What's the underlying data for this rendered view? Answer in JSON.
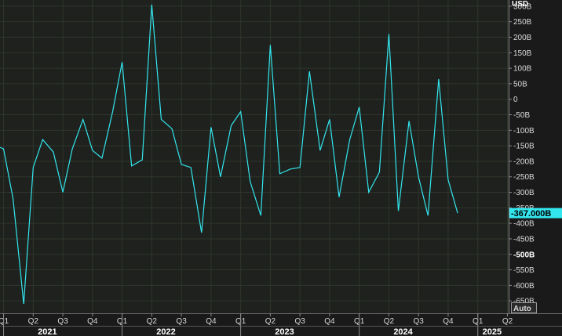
{
  "chart_data": {
    "type": "line",
    "unit_label": "USD",
    "auto_label": "Auto",
    "ylim": [
      -690,
      320
    ],
    "xlim": [
      2020.97,
      2025.26
    ],
    "grid": true,
    "line_color": "#33e6ee",
    "last_value_label": "-367.000B",
    "last_value": -367,
    "y_ticks": [
      {
        "value": 300,
        "label": "300B"
      },
      {
        "value": 250,
        "label": "250B"
      },
      {
        "value": 200,
        "label": "200B"
      },
      {
        "value": 150,
        "label": "150B"
      },
      {
        "value": 100,
        "label": "100B"
      },
      {
        "value": 50,
        "label": "50B"
      },
      {
        "value": 0,
        "label": "0"
      },
      {
        "value": -50,
        "label": "-50B"
      },
      {
        "value": -100,
        "label": "-100B"
      },
      {
        "value": -150,
        "label": "-150B"
      },
      {
        "value": -200,
        "label": "-200B"
      },
      {
        "value": -250,
        "label": "-250B"
      },
      {
        "value": -300,
        "label": "-300B"
      },
      {
        "value": -350,
        "label": "-350B"
      },
      {
        "value": -400,
        "label": "-400B"
      },
      {
        "value": -450,
        "label": "-450B"
      },
      {
        "value": -500,
        "label": "-500B"
      },
      {
        "value": -550,
        "label": "-550B"
      },
      {
        "value": -600,
        "label": "-600B"
      },
      {
        "value": -650,
        "label": "-650B"
      }
    ],
    "x_ticks": [
      {
        "value": 2021.0,
        "label": "Q1"
      },
      {
        "value": 2021.25,
        "label": "Q2"
      },
      {
        "value": 2021.5,
        "label": "Q3"
      },
      {
        "value": 2021.75,
        "label": "Q4"
      },
      {
        "value": 2022.0,
        "label": "Q1"
      },
      {
        "value": 2022.25,
        "label": "Q2"
      },
      {
        "value": 2022.5,
        "label": "Q3"
      },
      {
        "value": 2022.75,
        "label": "Q4"
      },
      {
        "value": 2023.0,
        "label": "Q1"
      },
      {
        "value": 2023.25,
        "label": "Q2"
      },
      {
        "value": 2023.5,
        "label": "Q3"
      },
      {
        "value": 2023.75,
        "label": "Q4"
      },
      {
        "value": 2024.0,
        "label": "Q1"
      },
      {
        "value": 2024.25,
        "label": "Q2"
      },
      {
        "value": 2024.5,
        "label": "Q3"
      },
      {
        "value": 2024.75,
        "label": "Q4"
      },
      {
        "value": 2025.0,
        "label": "Q1"
      },
      {
        "value": 2025.25,
        "label": "Q2"
      }
    ],
    "years": [
      {
        "value": 2021.37,
        "label": "2021"
      },
      {
        "value": 2022.37,
        "label": "2022"
      },
      {
        "value": 2023.37,
        "label": "2023"
      },
      {
        "value": 2024.37,
        "label": "2024"
      },
      {
        "value": 2025.12,
        "label": "2025"
      }
    ],
    "year_boundaries": [
      2021.0,
      2022.0,
      2023.0,
      2024.0,
      2025.0
    ],
    "series": [
      {
        "points": [
          [
            2020.97,
            -155
          ],
          [
            2021.0,
            -160
          ],
          [
            2021.08,
            -320
          ],
          [
            2021.17,
            -660
          ],
          [
            2021.25,
            -220
          ],
          [
            2021.33,
            -130
          ],
          [
            2021.42,
            -170
          ],
          [
            2021.5,
            -300
          ],
          [
            2021.58,
            -160
          ],
          [
            2021.67,
            -65
          ],
          [
            2021.75,
            -165
          ],
          [
            2021.83,
            -190
          ],
          [
            2021.92,
            -40
          ],
          [
            2022.0,
            120
          ],
          [
            2022.08,
            -215
          ],
          [
            2022.17,
            -195
          ],
          [
            2022.25,
            305
          ],
          [
            2022.33,
            -65
          ],
          [
            2022.42,
            -95
          ],
          [
            2022.5,
            -210
          ],
          [
            2022.58,
            -220
          ],
          [
            2022.67,
            -430
          ],
          [
            2022.75,
            -90
          ],
          [
            2022.83,
            -250
          ],
          [
            2022.92,
            -85
          ],
          [
            2023.0,
            -40
          ],
          [
            2023.08,
            -265
          ],
          [
            2023.17,
            -375
          ],
          [
            2023.25,
            175
          ],
          [
            2023.33,
            -240
          ],
          [
            2023.42,
            -225
          ],
          [
            2023.5,
            -220
          ],
          [
            2023.58,
            90
          ],
          [
            2023.67,
            -165
          ],
          [
            2023.75,
            -65
          ],
          [
            2023.83,
            -315
          ],
          [
            2023.92,
            -130
          ],
          [
            2024.0,
            -25
          ],
          [
            2024.08,
            -300
          ],
          [
            2024.17,
            -235
          ],
          [
            2024.25,
            210
          ],
          [
            2024.33,
            -360
          ],
          [
            2024.42,
            -70
          ],
          [
            2024.5,
            -250
          ],
          [
            2024.58,
            -375
          ],
          [
            2024.67,
            65
          ],
          [
            2024.75,
            -260
          ],
          [
            2024.83,
            -367
          ]
        ]
      }
    ]
  }
}
